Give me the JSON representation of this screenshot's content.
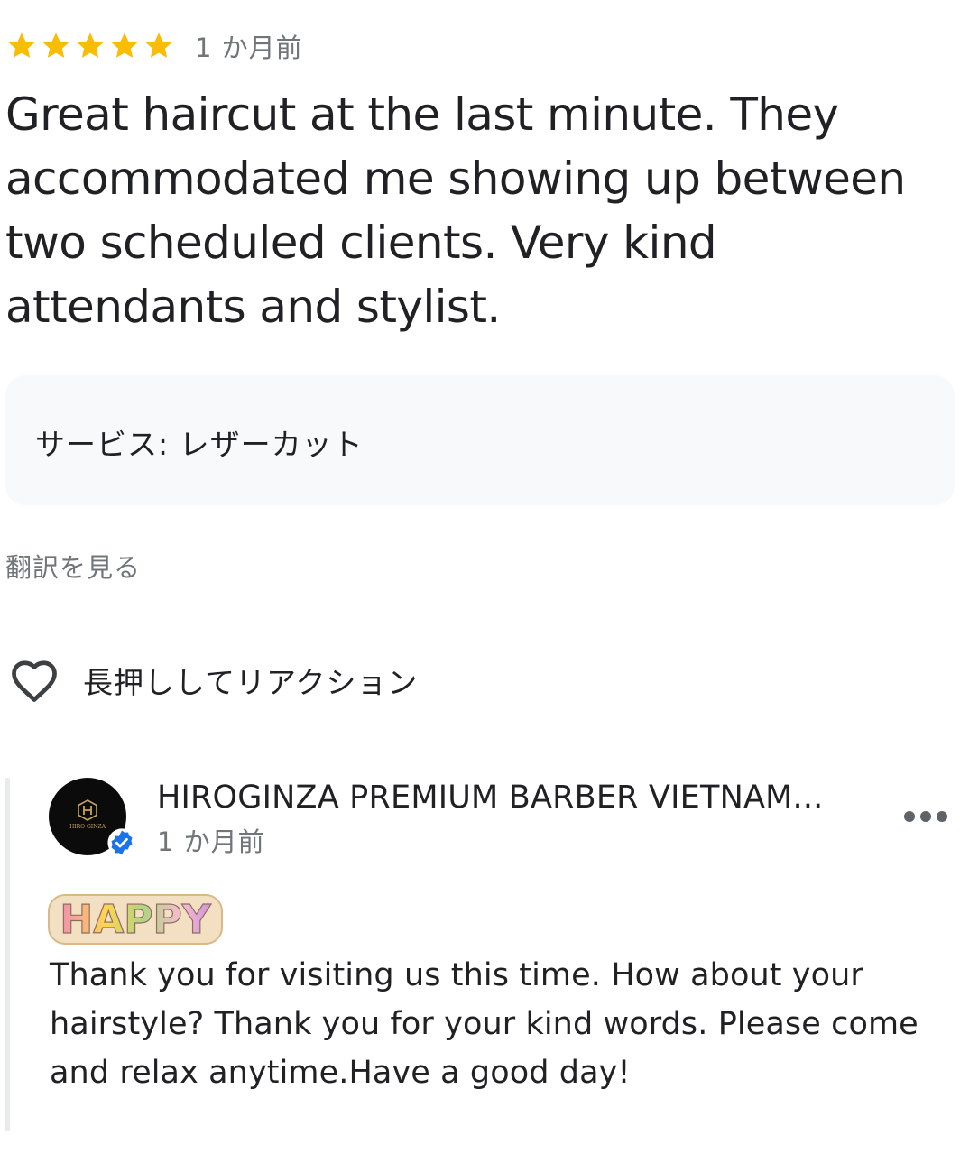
{
  "review": {
    "rating": 5,
    "rating_max": 5,
    "star_color": "#fbbc04",
    "date": "1 か月前",
    "text": "Great haircut at the last minute. They accommodated me showing up between two scheduled clients. Very kind attendants and stylist."
  },
  "service": {
    "text": "サービス: レザーカット"
  },
  "translate": {
    "label": "翻訳を見る"
  },
  "reaction": {
    "icon": "heart-outline-icon",
    "label": "長押ししてリアクション"
  },
  "owner_reply": {
    "name": "HIROGINZA PREMIUM BARBER VIETNAM...",
    "date": "1 か月前",
    "avatar_text": "HIRO GINZA",
    "verified": true,
    "verified_color": "#1a73e8",
    "more_icon": "more-horizontal-icon",
    "sticker_text": "HAPPY",
    "text": "Thank you for visiting us this time. How about your hairstyle? Thank you for your kind words. Please come and relax anytime.Have a good day!"
  }
}
